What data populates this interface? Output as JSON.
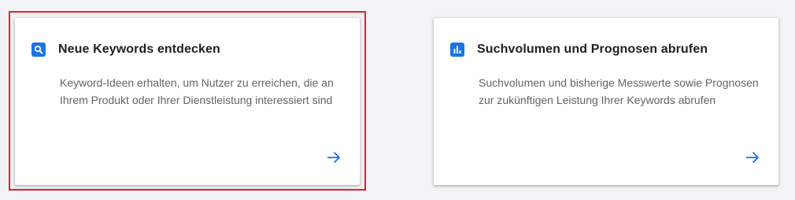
{
  "cards": [
    {
      "title": "Neue Keywords entdecken",
      "description": "Keyword-Ideen erhalten, um Nutzer zu erreichen, die an Ihrem Produkt oder Ihrer Dienstleistung interessiert sind",
      "icon": "search-icon",
      "selected": true
    },
    {
      "title": "Suchvolumen und Prognosen abrufen",
      "description": "Suchvolumen und bisherige Messwerte sowie Prognosen zur zukünftigen Leistung Ihrer Keywords abrufen",
      "icon": "bar-chart-icon",
      "selected": false
    }
  ],
  "colors": {
    "accent": "#1a73e8",
    "selection_outline": "#e5202e",
    "background": "#f1f3f4"
  }
}
